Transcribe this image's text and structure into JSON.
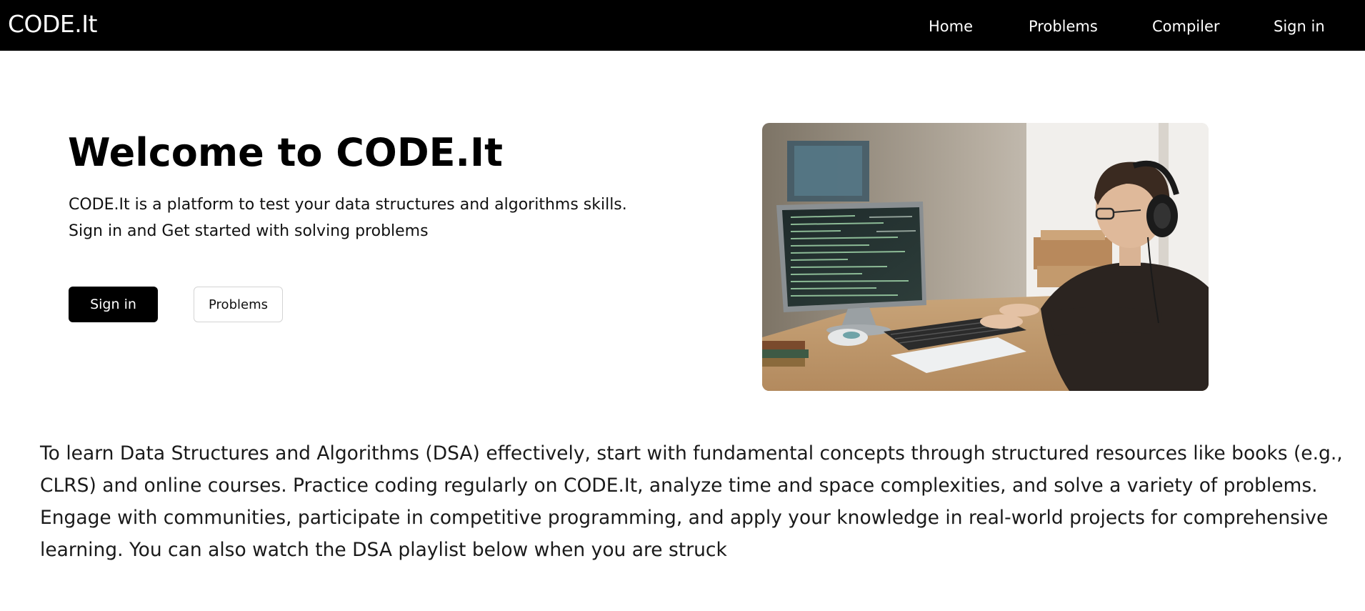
{
  "navbar": {
    "brand": "CODE.It",
    "links": [
      {
        "label": "Home"
      },
      {
        "label": "Problems"
      },
      {
        "label": "Compiler"
      },
      {
        "label": "Sign in"
      }
    ]
  },
  "hero": {
    "title": "Welcome to CODE.It",
    "description_lines": [
      "CODE.It is a platform to test your data structures and algorithms skills.",
      "Sign in and Get started with solving problems"
    ],
    "primary_button": "Sign in",
    "secondary_button": "Problems",
    "image": "person-coding-at-desk-photo"
  },
  "about": {
    "lines": [
      "To learn Data Structures and Algorithms (DSA) effectively, start with fundamental concepts through structured resources like books (e.g.,",
      "CLRS) and online courses. Practice coding regularly on CODE.It, analyze time and space complexities, and solve a variety of problems.",
      "Engage with communities, participate in competitive programming, and apply your knowledge in real-world projects for comprehensive",
      "learning. You can also watch the DSA playlist below when you are struck"
    ]
  },
  "colors": {
    "navbar_bg": "#000000",
    "primary_button_bg": "#000000",
    "page_bg": "#ffffff"
  }
}
